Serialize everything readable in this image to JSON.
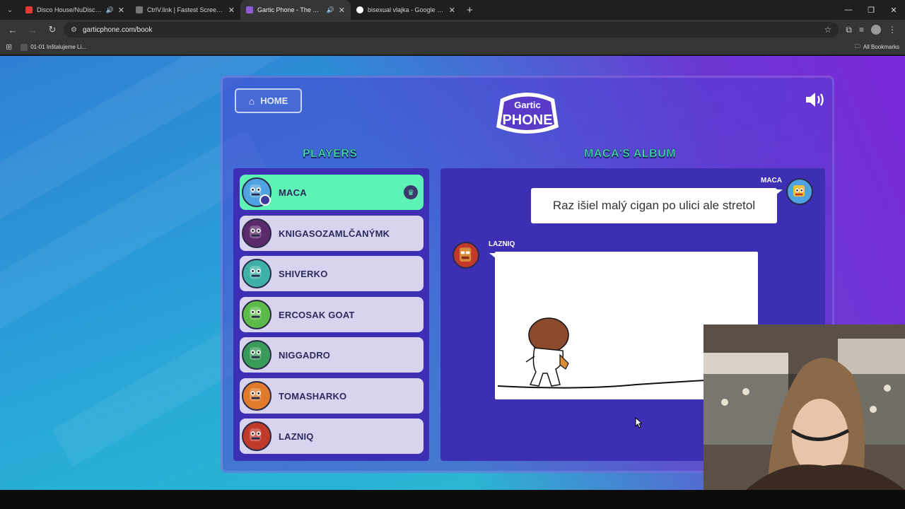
{
  "browser": {
    "tabs": [
      {
        "title": "Disco House/NuDisco Meg",
        "favicon_color": "#e53935",
        "sound": true,
        "active": false
      },
      {
        "title": "CtrlV.link | Fastest ScreenShot a",
        "favicon_color": "#777777",
        "sound": false,
        "active": false
      },
      {
        "title": "Gartic Phone - The Telepho",
        "favicon_color": "#8e5bd6",
        "sound": true,
        "active": true
      },
      {
        "title": "bisexual vlajka - Google Search",
        "favicon_color": "#ffffff",
        "sound": false,
        "active": false
      }
    ],
    "url": "garticphone.com/book",
    "bookmark": "01-01 Inštalujeme Li...",
    "all_bookmarks": "All Bookmarks"
  },
  "page": {
    "home_label": "HOME",
    "logo_top": "Gartic",
    "logo_bottom": "PHONE",
    "players_title": "PLAYERS",
    "album_title": "MACA'S ALBUM",
    "players": [
      {
        "name": "MACA",
        "active": true,
        "color": "#4fa3e0"
      },
      {
        "name": "KNIGASOZAMLČANÝMK",
        "active": false,
        "color": "#5b2a6a"
      },
      {
        "name": "SHIVERKO",
        "active": false,
        "color": "#3fb0a8"
      },
      {
        "name": "ERCOSAK GOAT",
        "active": false,
        "color": "#5dbb4a"
      },
      {
        "name": "NIGGADRO",
        "active": false,
        "color": "#3a9a5a"
      },
      {
        "name": "TOMASHARKO",
        "active": false,
        "color": "#e07a2a"
      },
      {
        "name": "LAZNIQ",
        "active": false,
        "color": "#c0392b"
      }
    ],
    "album": {
      "first_author": "MACA",
      "first_text": "Raz išiel malý cigan po ulici ale stretol",
      "second_author": "LAZNIQ"
    }
  }
}
